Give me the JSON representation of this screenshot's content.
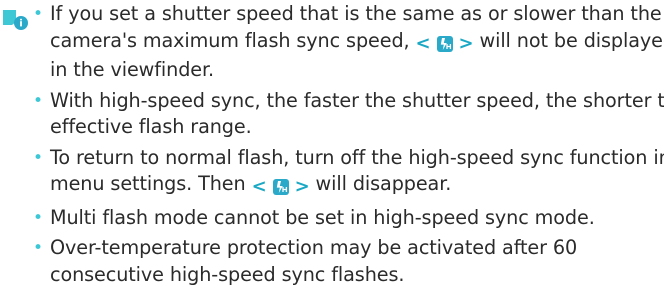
{
  "notes": [
    {
      "lines": [
        "If you set a shutter speed that is the same as or slower than the",
        "camera's maximum flash sync speed, ",
        " will not be displayed",
        "in the viewfinder."
      ]
    },
    {
      "lines": [
        "With high-speed sync, the faster the shutter speed, the shorter the",
        "effective flash range."
      ]
    },
    {
      "lines": [
        "To return to normal flash, turn off the high-speed sync function in",
        "menu settings. Then ",
        " will disappear."
      ]
    },
    {
      "lines": [
        "Multi flash mode cannot be set in high-speed sync mode."
      ]
    },
    {
      "lines": [
        "Over-temperature protection may be activated after 60",
        "consecutive high-speed sync flashes."
      ]
    }
  ],
  "symbol": {
    "open": "<",
    "close": ">",
    "icon": "high-speed-sync-icon"
  },
  "icons": {
    "note": "note-info-icon"
  },
  "colors": {
    "accent": "#3ec8d6",
    "icon_blue": "#2aa9c9",
    "text": "#2b2b2b"
  }
}
